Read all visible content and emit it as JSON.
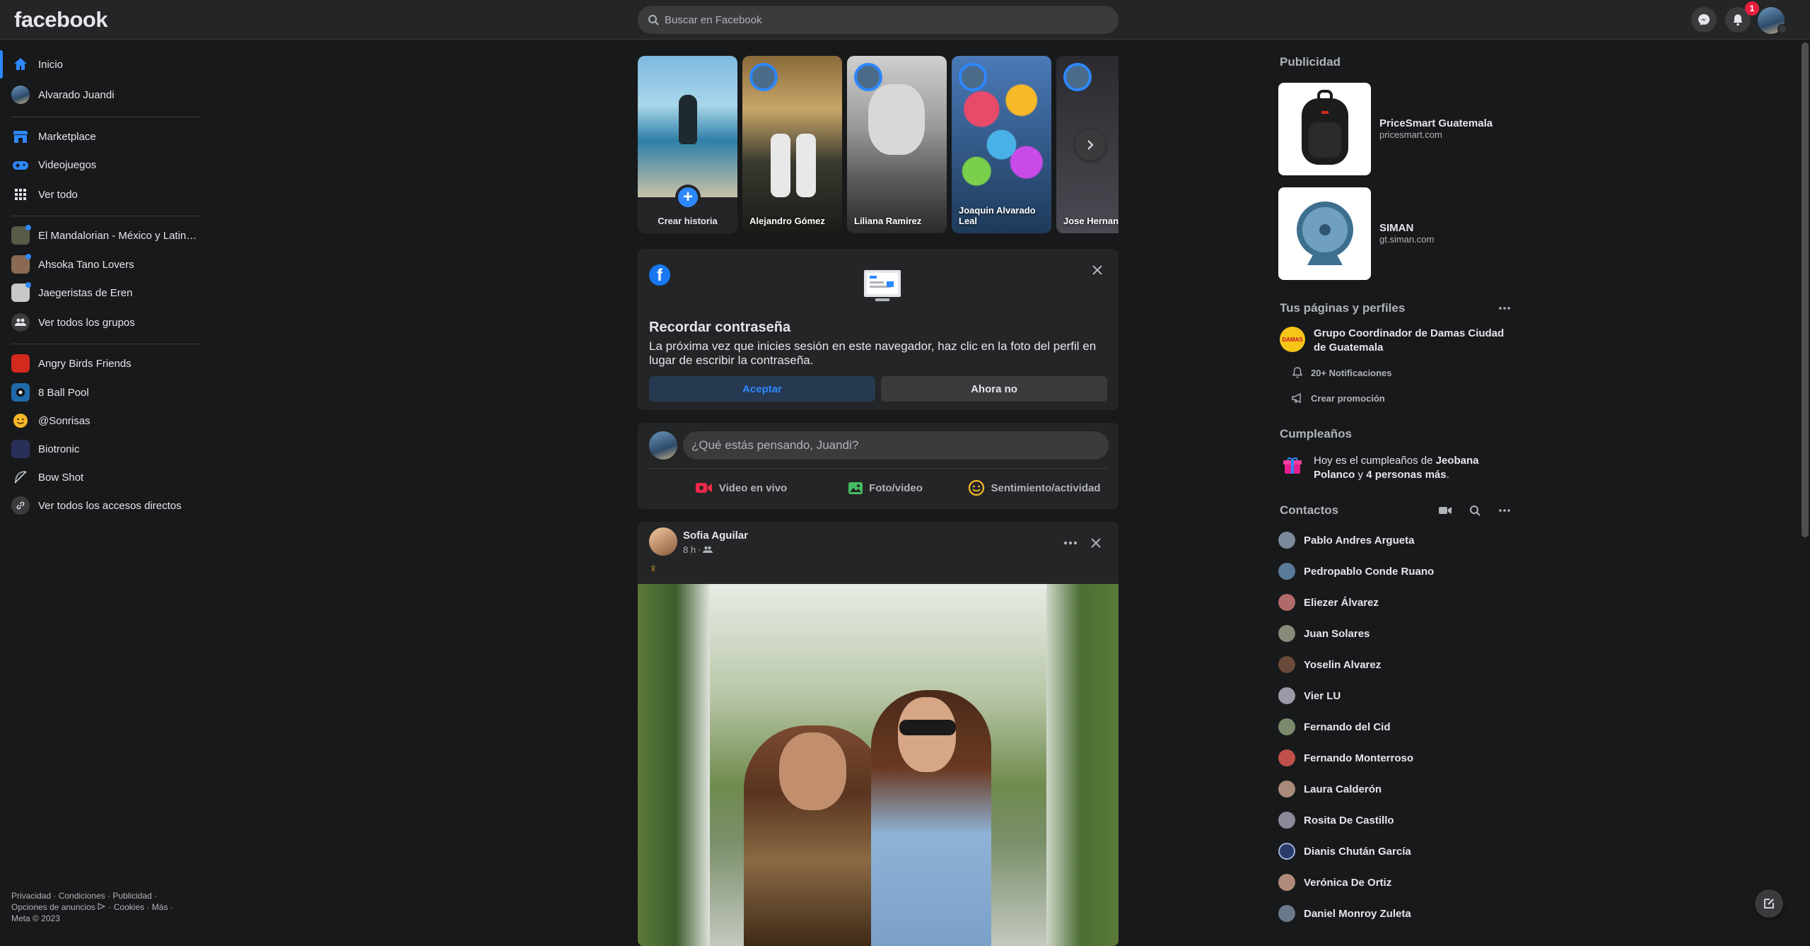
{
  "header": {
    "logo": "facebook",
    "search_placeholder": "Buscar en Facebook",
    "notifications_count": "1"
  },
  "sidebar": {
    "items": [
      {
        "label": "Inicio",
        "icon": "home-icon"
      },
      {
        "label": "Alvarado Juandi",
        "icon": "avatar"
      },
      {
        "label": "Marketplace",
        "icon": "marketplace-icon"
      },
      {
        "label": "Videojuegos",
        "icon": "gamepad-icon"
      },
      {
        "label": "Ver todo",
        "icon": "grid-icon"
      }
    ],
    "groups": [
      {
        "label": "El Mandalorian - México y Latinoamérica"
      },
      {
        "label": "Ahsoka Tano Lovers"
      },
      {
        "label": "Jaegeristas de Eren"
      },
      {
        "label": "Ver todos los grupos"
      }
    ],
    "shortcuts": [
      {
        "label": "Angry Birds Friends"
      },
      {
        "label": "8 Ball Pool"
      },
      {
        "label": "@Sonrisas"
      },
      {
        "label": "Biotronic"
      },
      {
        "label": "Bow Shot"
      },
      {
        "label": "Ver todos los accesos directos"
      }
    ],
    "footer": {
      "l1": [
        "Privacidad",
        "Condiciones",
        "Publicidad"
      ],
      "l2": [
        "Opciones de anuncios",
        "Cookies",
        "Más"
      ],
      "copyright": "Meta © 2023"
    }
  },
  "stories": {
    "create_label": "Crear historia",
    "items": [
      {
        "name": "Alejandro Gómez"
      },
      {
        "name": "Liliana Ramirez"
      },
      {
        "name": "Joaquin Alvarado Leal"
      },
      {
        "name": "Jose Hernandez"
      }
    ]
  },
  "password_card": {
    "title": "Recordar contraseña",
    "text": "La próxima vez que inicies sesión en este navegador, haz clic en la foto del perfil en lugar de escribir la contraseña.",
    "accept": "Aceptar",
    "decline": "Ahora no"
  },
  "composer": {
    "placeholder": "¿Qué estás pensando, Juandi?",
    "actions": [
      "Video en vivo",
      "Foto/video",
      "Sentimiento/actividad"
    ]
  },
  "post": {
    "author": "Sofia Aguilar",
    "time": "8 h",
    "separator": "·",
    "emoji": "♀"
  },
  "right": {
    "ads_title": "Publicidad",
    "ads": [
      {
        "title": "PriceSmart Guatemala",
        "url": "pricesmart.com"
      },
      {
        "title": "SIMAN",
        "url": "gt.siman.com"
      }
    ],
    "pages_title": "Tus páginas y perfiles",
    "page_name": "Grupo Coordinador de Damas Ciudad de Guatemala",
    "page_notifications": "20+ Notificaciones",
    "page_promo": "Crear promoción",
    "birthdays_title": "Cumpleaños",
    "birthday_text": [
      "Hoy es el cumpleaños de ",
      "Jeobana Polanco",
      " y ",
      "4 personas más",
      "."
    ],
    "contacts_title": "Contactos",
    "contacts": [
      "Pablo Andres Argueta",
      "Pedropablo Conde Ruano",
      "Eliezer Álvarez",
      "Juan Solares",
      "Yoselin Alvarez",
      "Vier LU",
      "Fernando del Cid",
      "Fernando Monterroso",
      "Laura Calderón",
      "Rosita De Castillo",
      "Dianis Chután García",
      "Verónica De Ortiz",
      "Daniel Monroy Zuleta"
    ]
  },
  "colors": {
    "accent": "#2d88ff",
    "bg": "#18191a",
    "card": "#242526"
  }
}
